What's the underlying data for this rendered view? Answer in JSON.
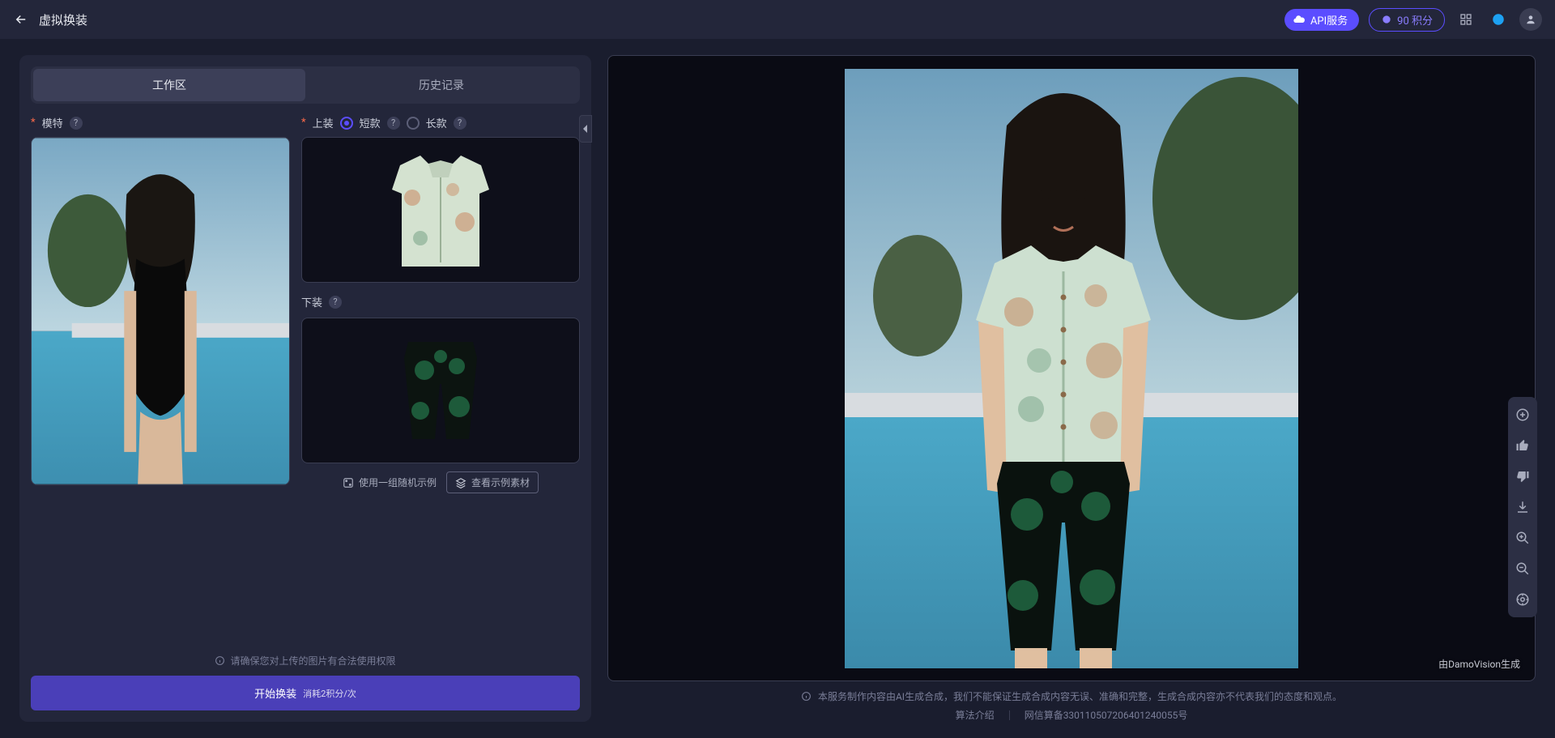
{
  "header": {
    "title": "虚拟换装",
    "api_button": "API服务",
    "credits": "90 积分"
  },
  "left": {
    "tabs": {
      "workspace": "工作区",
      "history": "历史记录"
    },
    "model_label": "模特",
    "top_label": "上装",
    "top_short": "短款",
    "top_long": "长款",
    "bottom_label": "下装",
    "random_sample": "使用一组随机示例",
    "view_samples": "查看示例素材",
    "legal_note": "请确保您对上传的图片有合法使用权限",
    "start_button": "开始换装",
    "start_cost": "消耗2积分/次"
  },
  "right": {
    "watermark": "由DamoVision生成",
    "disclaimer": "本服务制作内容由AI生成合成，我们不能保证生成合成内容无误、准确和完整，生成合成内容亦不代表我们的态度和观点。",
    "footer_algo": "算法介绍",
    "footer_filing": "网信算备330110507206401240055号"
  }
}
